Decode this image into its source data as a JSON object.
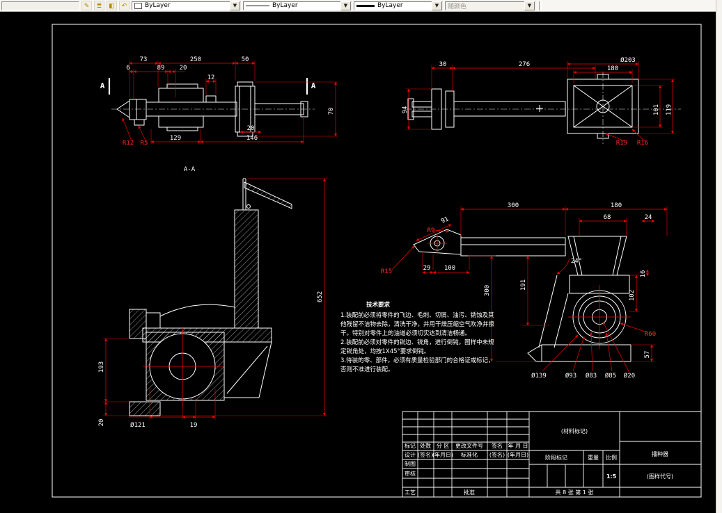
{
  "toolbar": {
    "color": "ByLayer",
    "linetype": "ByLayer",
    "lineweight": "ByLayer",
    "plot_style": "随颜色",
    "chevron": "▼"
  },
  "colors": {
    "background": "#000000",
    "geometry": "#ffffff",
    "dimension": "#f20000"
  },
  "views": {
    "front": {
      "section_label": "A",
      "dims": {
        "d73": "73",
        "d250": "250",
        "d50": "50",
        "d6": "6",
        "d89": "89",
        "d20_top": "20",
        "d12": "12",
        "d70": "70",
        "d20_bottom": "20",
        "d129": "129",
        "d146": "146",
        "r12": "R12",
        "r5": "R5"
      }
    },
    "top": {
      "dims": {
        "d30": "30",
        "d276": "276",
        "d203": "Ø203",
        "d180": "180",
        "d94": "94",
        "d101": "101",
        "d119": "119",
        "r19": "R19",
        "r16": "R16"
      }
    },
    "section_aa": {
      "label": "A-A",
      "dims": {
        "d652": "652",
        "d193": "193",
        "d20": "20",
        "d121": "Ø121",
        "d19": "19"
      }
    },
    "side": {
      "dims": {
        "d300_top": "300",
        "d180": "180",
        "d68": "68",
        "d24": "24",
        "d91": "91",
        "r9": "R9",
        "r15": "R15",
        "d29": "29",
        "d100": "100",
        "d300_v": "300",
        "d191": "191",
        "a24": "24°",
        "d102": "102",
        "d16": "16",
        "r60": "R60",
        "d57": "57",
        "dia139": "Ø139",
        "dia93": "Ø93",
        "dia83": "Ø83",
        "dia85": "Ø85",
        "dia20": "Ø20"
      }
    }
  },
  "tech_requirements": {
    "title": "技术要求",
    "lines": [
      "1.装配前必须将零件的飞边、毛刺、切屑、油污、锈蚀及其",
      "他残留不洁物去除，清洗干净，并用干燥压缩空气吹净并擦",
      "干。特别对零件上的油道必须切实达到清洁畅通。",
      "2.装配前必须对零件的锐边、锐角，进行倒钝，图样中未规",
      "定锐角处，均按1X45°要求倒钝。",
      "3.待装的零、部件，必须有质量检验部门的合格证或标记，",
      "否则不准进行装配。"
    ]
  },
  "title_block": {
    "rev_header": [
      "标记",
      "处数",
      "分 区",
      "更改文件号",
      "签名",
      "年 月 日"
    ],
    "design_row": [
      "设计",
      "(签名)",
      "(年月日)",
      "标准化",
      "(签名)",
      "(年月日)"
    ],
    "draw_label": "制图",
    "check_label": "审核",
    "process_label": "工艺",
    "approve_label": "批准",
    "material_mark": "(材料标记)",
    "stage_mark": "阶段标记",
    "weight_label": "重量",
    "scale_label": "比例",
    "scale_value": "1:5",
    "sheet_info": "共 8 张  第 1 张",
    "part_name": "播种器",
    "drawing_code": "(图样代号)"
  }
}
